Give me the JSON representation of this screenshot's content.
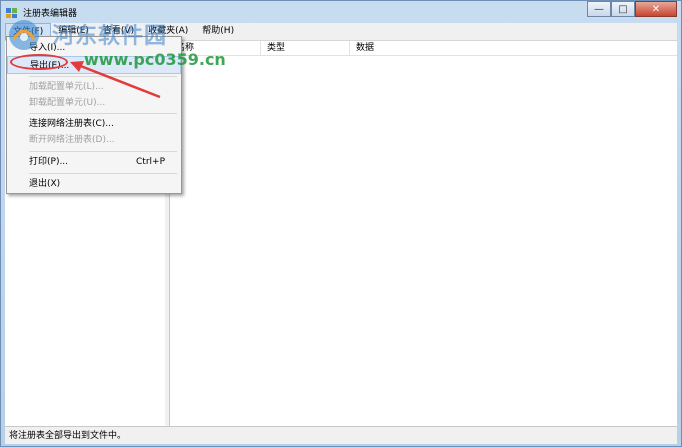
{
  "window": {
    "title": "注册表编辑器"
  },
  "window_controls": {
    "minimize": "—",
    "maximize": "□",
    "close": "✕"
  },
  "menubar": {
    "items": [
      "文件(F)",
      "编辑(E)",
      "查看(V)",
      "收藏夹(A)",
      "帮助(H)"
    ]
  },
  "list": {
    "columns": [
      "名称",
      "类型",
      "数据"
    ]
  },
  "file_menu": {
    "items": [
      {
        "label": "导入(I)...",
        "enabled": true
      },
      {
        "label": "导出(E)...",
        "enabled": true
      },
      {
        "label": "加载配置单元(L)...",
        "enabled": false
      },
      {
        "label": "卸载配置单元(U)...",
        "enabled": false
      },
      {
        "label": "连接网络注册表(C)...",
        "enabled": true
      },
      {
        "label": "断开网络注册表(D)...",
        "enabled": false
      },
      {
        "label": "打印(P)...",
        "enabled": true,
        "shortcut": "Ctrl+P"
      },
      {
        "label": "退出(X)",
        "enabled": true
      }
    ]
  },
  "statusbar": {
    "text": "将注册表全部导出到文件中。"
  },
  "watermark": {
    "title": "河东软件园",
    "url": "www.pc0359.cn"
  },
  "colors": {
    "annotation": "#e23b3b",
    "watermark_url": "#1e963c"
  }
}
